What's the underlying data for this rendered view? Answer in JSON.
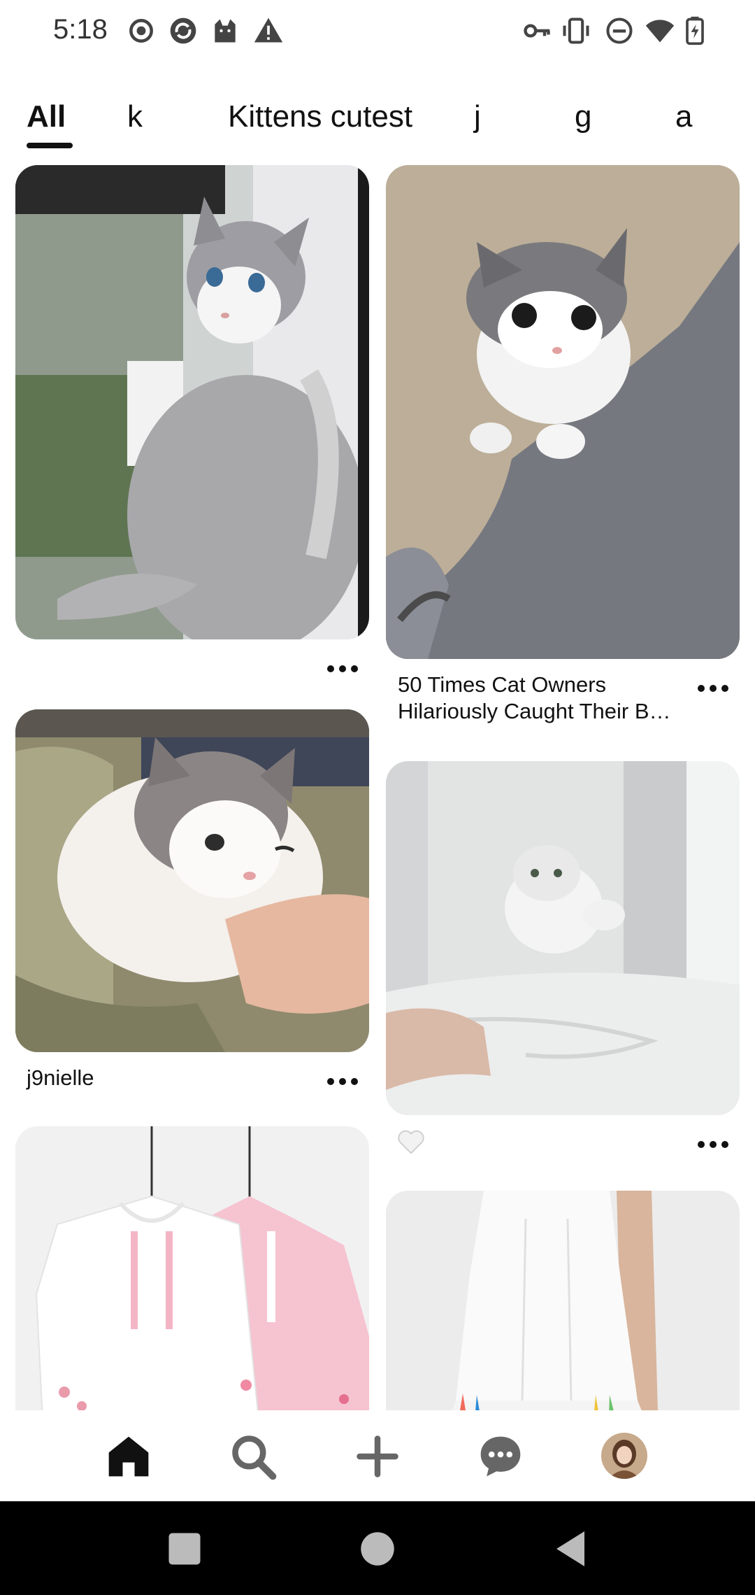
{
  "status_bar": {
    "time": "5:18",
    "left_icons": [
      "record-icon",
      "sync-icon",
      "cat-icon",
      "warning-icon"
    ],
    "right_icons": [
      "vpn-key-icon",
      "vibrate-icon",
      "do-not-disturb-icon",
      "wifi-icon",
      "battery-charging-icon"
    ]
  },
  "tabs": [
    {
      "label": "All",
      "active": true
    },
    {
      "label": "k",
      "active": false
    },
    {
      "label": "Kittens cutest",
      "active": false
    },
    {
      "label": "j",
      "active": false
    },
    {
      "label": "g",
      "active": false
    },
    {
      "label": "a",
      "active": false
    }
  ],
  "pins": [
    {
      "image": "grey-white-cat-by-window",
      "title": "",
      "more": "more-options"
    },
    {
      "image": "kitten-on-grey-sweater",
      "title": "50 Times Cat Owners Hilariously Caught Their B…",
      "more": "more-options"
    },
    {
      "image": "fluffy-cat-on-arm",
      "title": "j9nielle",
      "more": "more-options"
    },
    {
      "image": "white-kitten-jumping-on-bed",
      "title": "",
      "reaction": "heart-icon",
      "more": "more-options"
    },
    {
      "image": "white-and-pink-hoodies",
      "title": ""
    },
    {
      "image": "white-pleated-dress"
    }
  ],
  "bottom_nav": [
    "home-icon",
    "search-icon",
    "create-plus-icon",
    "messages-icon",
    "profile-avatar"
  ],
  "system_nav": [
    "recents-square",
    "home-circle",
    "back-triangle"
  ],
  "colors": {
    "text": "#111111",
    "status_text": "#333333",
    "system_nav_bg": "#000000",
    "nav_button": "#bbbbbb"
  }
}
